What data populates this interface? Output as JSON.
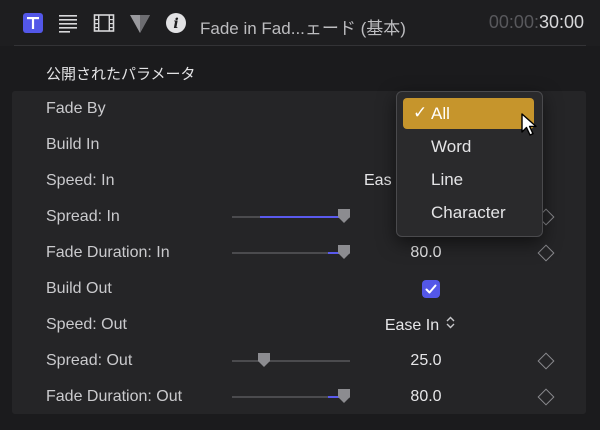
{
  "toolbar": {
    "icons": [
      {
        "name": "text-inspector-icon",
        "glyph": "T"
      },
      {
        "name": "lines-icon"
      },
      {
        "name": "film-icon"
      },
      {
        "name": "triangle-icon"
      },
      {
        "name": "info-icon",
        "glyph": "i"
      }
    ],
    "title": "Fade in Fad...ェード (基本)",
    "time_dim": "00:00:",
    "time_bright": "30:00"
  },
  "section": {
    "header": "公開されたパラメータ"
  },
  "params": {
    "fade_by": {
      "label": "Fade By"
    },
    "build_in": {
      "label": "Build In"
    },
    "speed_in": {
      "label": "Speed: In",
      "value_partial": "Eas"
    },
    "spread_in": {
      "label": "Spread: In"
    },
    "fade_duration_in": {
      "label": "Fade Duration: In",
      "value": "80.0"
    },
    "build_out": {
      "label": "Build Out",
      "checked": true
    },
    "speed_out": {
      "label": "Speed: Out",
      "value": "Ease In",
      "arrows": "◇"
    },
    "spread_out": {
      "label": "Spread: Out",
      "value": "25.0"
    },
    "fade_duration_out": {
      "label": "Fade Duration: Out",
      "value": "80.0"
    }
  },
  "sliders": {
    "spread_in": 0.95,
    "fade_duration_in": 0.95,
    "spread_out": 0.27,
    "fade_duration_out": 0.95
  },
  "menu": {
    "selected_index": 0,
    "check": "✓",
    "items": [
      "All",
      "Word",
      "Line",
      "Character"
    ]
  },
  "colors": {
    "accent": "#5a5aee",
    "checkbox": "#5357e8",
    "menu_highlight": "#c6952c"
  }
}
